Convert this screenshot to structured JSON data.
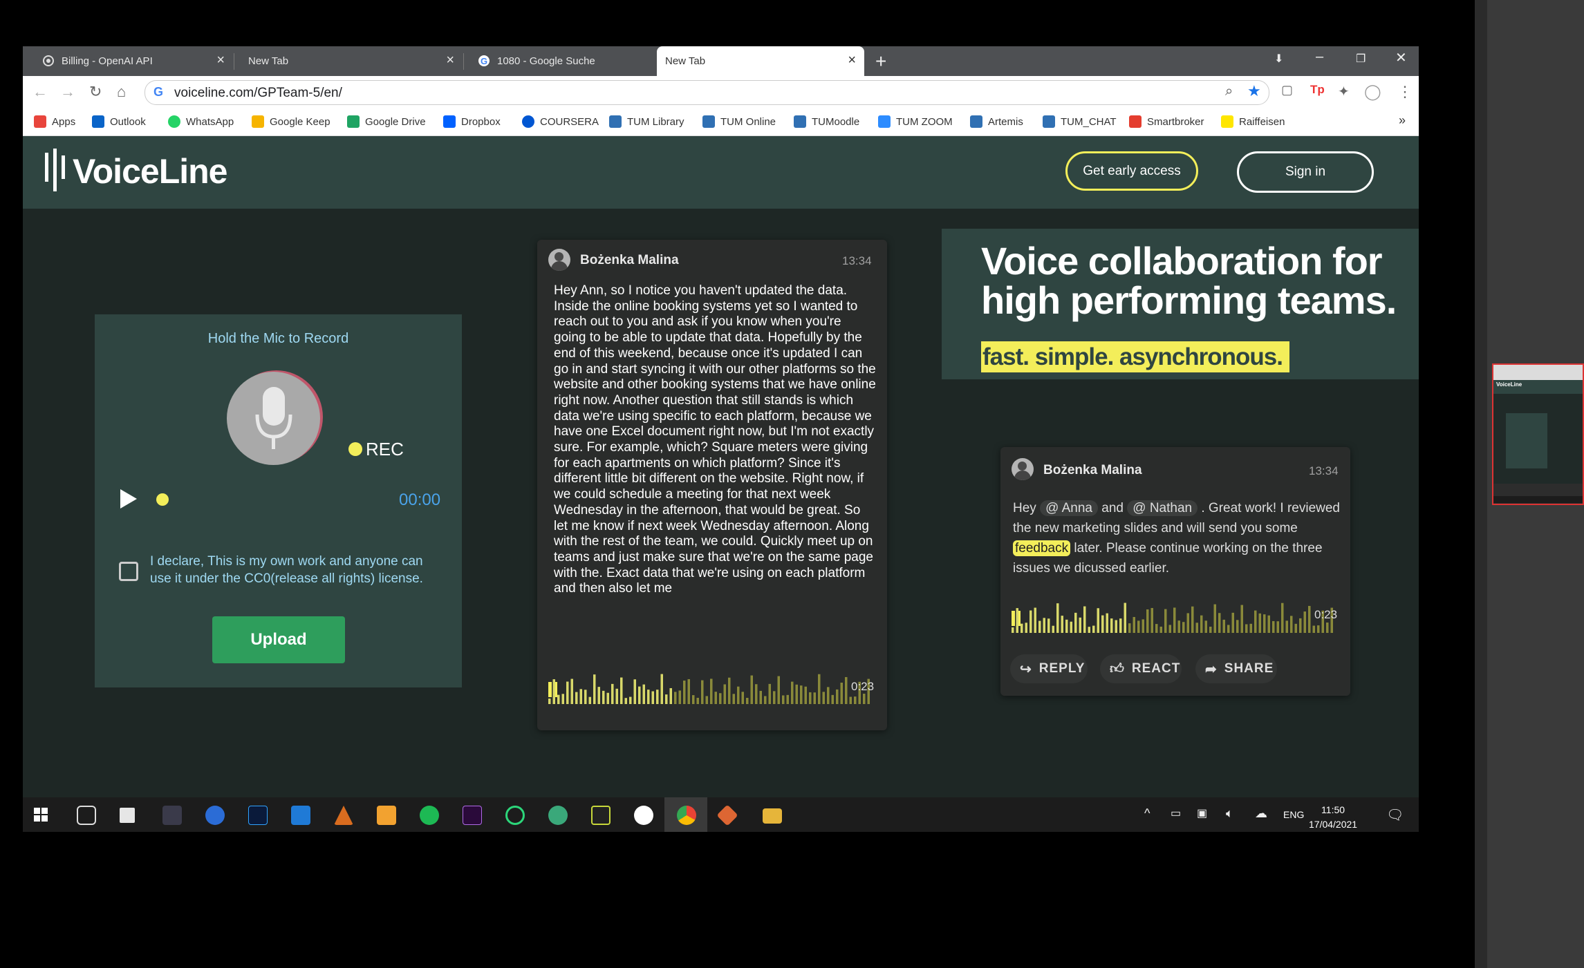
{
  "browser": {
    "tabs": [
      {
        "title": "Billing - OpenAI API",
        "icon": "openai-icon"
      },
      {
        "title": "New Tab",
        "icon": "none"
      },
      {
        "title": "1080 - Google Suche",
        "icon": "google-icon"
      },
      {
        "title": "New Tab",
        "icon": "none",
        "active": true
      }
    ],
    "url": "voiceline.com/GPTeam-5/en/",
    "bookmarks": [
      {
        "label": "Apps",
        "color": "#e8453c"
      },
      {
        "label": "Outlook",
        "color": "#0a64c8"
      },
      {
        "label": "WhatsApp",
        "color": "#25d366"
      },
      {
        "label": "Google Keep",
        "color": "#f6b400"
      },
      {
        "label": "Google Drive",
        "color": "#1fa463"
      },
      {
        "label": "Dropbox",
        "color": "#0061ff"
      },
      {
        "label": "COURSERA",
        "color": "#0056d2"
      },
      {
        "label": "TUM Library",
        "color": "#3070b3"
      },
      {
        "label": "TUM Online",
        "color": "#3070b3"
      },
      {
        "label": "TUMoodle",
        "color": "#3070b3"
      },
      {
        "label": "TUM ZOOM",
        "color": "#2d8cff"
      },
      {
        "label": "Artemis",
        "color": "#3070b3"
      },
      {
        "label": "TUM_CHAT",
        "color": "#3070b3"
      },
      {
        "label": "Smartbroker",
        "color": "#e43d2f"
      },
      {
        "label": "Raiffeisen",
        "color": "#fee600"
      }
    ],
    "more_bookmarks": "»"
  },
  "site": {
    "logo": "VoiceLine",
    "nav": {
      "early_access": "Get early access",
      "sign_in": "Sign in"
    },
    "accent": "#f3ee5a",
    "brand_bg": "#2f4541"
  },
  "recorder": {
    "title": "Hold the Mic to Record",
    "rec_label": "REC",
    "timer": "00:00",
    "declaration": "I declare, This is my own work and anyone can use it under the CC0(release all rights) license.",
    "upload": "Upload"
  },
  "message1": {
    "name": "Bożenka Malina",
    "time": "13:34",
    "text": "Hey Ann, so I notice you haven't updated the data. Inside the online booking systems yet so I wanted to reach out to you and ask if you know when you're going to be able to update that data. Hopefully by the end of this weekend, because once it's updated I can go in and start syncing it with our other platforms so the website and other booking systems that we have online right now. Another question that still stands is which data we're using specific to each platform, because we have one Excel document right now, but I'm not exactly sure. For example, which? Square meters were giving for each apartments on which platform? Since it's different little bit different on the website. Right now, if we could schedule a meeting for that next week Wednesday in the afternoon, that would be great. So let me know if next week Wednesday afternoon. Along with the rest of the team, we could. Quickly meet up on teams and just make sure that we're on the same page with the. Exact data that we're using on each platform and then also let me",
    "duration": "0:23"
  },
  "hero": {
    "title": "Voice collaboration for high performing teams.",
    "subtitle": "fast. simple. asynchronous."
  },
  "message2": {
    "name": "Bożenka Malina",
    "time": "13:34",
    "part1": "Hey ",
    "mention1": "@ Anna",
    "part2": " and ",
    "mention2": "@ Nathan",
    "part3": " . Great work! I reviewed the new marketing slides and will send you some ",
    "highlight": "feedback",
    "part4": " later. Please continue working on the three issues we dicussed earlier.",
    "duration": "0:23",
    "actions": {
      "reply": "REPLY",
      "react": "REACT",
      "share": "SHARE"
    }
  },
  "taskbar": {
    "lang": "ENG",
    "time": "11:50",
    "date": "17/04/2021"
  }
}
